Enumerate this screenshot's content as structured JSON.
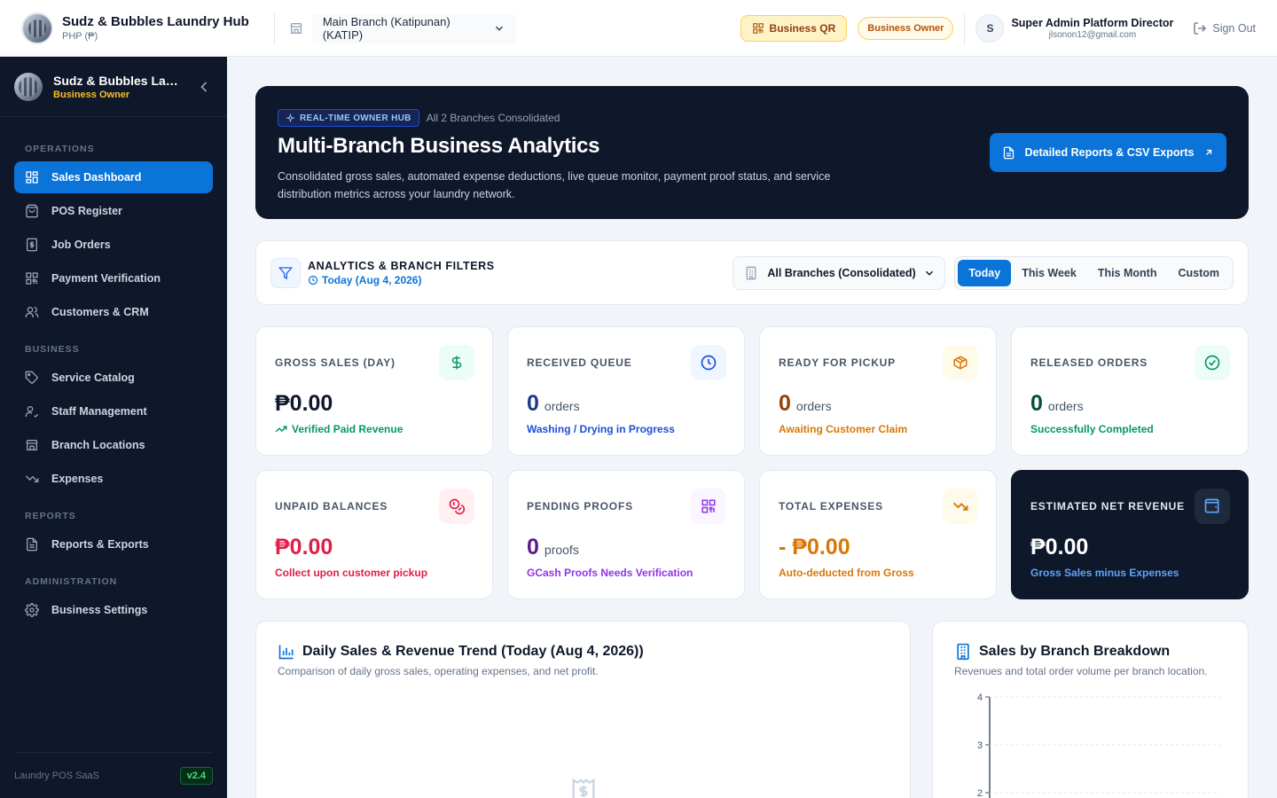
{
  "header": {
    "brand_name": "Sudz & Bubbles Laundry Hub",
    "currency": "PHP (₱)",
    "branch_select": "Main Branch (Katipunan) (KATIP)",
    "business_qr": "Business QR",
    "role_badge": "Business Owner",
    "user_initial": "S",
    "user_name": "Super Admin Platform Director",
    "user_email": "jlsonon12@gmail.com",
    "sign_out": "Sign Out"
  },
  "sidebar": {
    "name": "Sudz & Bubbles Laundry Hub",
    "role": "Business Owner",
    "sections": [
      {
        "title": "OPERATIONS",
        "items": [
          {
            "label": "Sales Dashboard",
            "icon": "dashboard-icon",
            "active": true
          },
          {
            "label": "POS Register",
            "icon": "pos-icon"
          },
          {
            "label": "Job Orders",
            "icon": "job-orders-icon"
          },
          {
            "label": "Payment Verification",
            "icon": "qr-verify-icon"
          },
          {
            "label": "Customers & CRM",
            "icon": "users-icon"
          }
        ]
      },
      {
        "title": "BUSINESS",
        "items": [
          {
            "label": "Service Catalog",
            "icon": "tag-icon"
          },
          {
            "label": "Staff Management",
            "icon": "staff-icon"
          },
          {
            "label": "Branch Locations",
            "icon": "store-icon"
          },
          {
            "label": "Expenses",
            "icon": "trend-down-icon"
          }
        ]
      },
      {
        "title": "REPORTS",
        "items": [
          {
            "label": "Reports & Exports",
            "icon": "document-icon"
          }
        ]
      },
      {
        "title": "ADMINISTRATION",
        "items": [
          {
            "label": "Business Settings",
            "icon": "gear-icon"
          }
        ]
      }
    ],
    "footer_label": "Laundry POS SaaS",
    "version": "v2.4"
  },
  "hero": {
    "tag": "REAL-TIME OWNER HUB",
    "subtitle": "All 2 Branches Consolidated",
    "title": "Multi-Branch Business Analytics",
    "description": "Consolidated gross sales, automated expense deductions, live queue monitor, payment proof status, and service distribution metrics across your laundry network.",
    "button": "Detailed Reports & CSV Exports"
  },
  "filters": {
    "title": "ANALYTICS & BRANCH FILTERS",
    "date": "Today (Aug 4, 2026)",
    "branch_select": "All Branches (Consolidated)",
    "ranges": [
      "Today",
      "This Week",
      "This Month",
      "Custom"
    ],
    "active_range": "Today"
  },
  "cards": [
    {
      "label": "GROSS SALES (DAY)",
      "value": "₱0.00",
      "unit": "",
      "note": "Verified Paid Revenue",
      "icon": "dollar-icon",
      "accent": "#059669"
    },
    {
      "label": "RECEIVED QUEUE",
      "value": "0",
      "unit": "orders",
      "note": "Washing / Drying in Progress",
      "icon": "clock-icon",
      "accent": "#1d4ed8"
    },
    {
      "label": "READY FOR PICKUP",
      "value": "0",
      "unit": "orders",
      "note": "Awaiting Customer Claim",
      "icon": "package-icon",
      "accent": "#d97706"
    },
    {
      "label": "RELEASED ORDERS",
      "value": "0",
      "unit": "orders",
      "note": "Successfully Completed",
      "icon": "check-circle-icon",
      "accent": "#059669"
    },
    {
      "label": "UNPAID BALANCES",
      "value": "₱0.00",
      "unit": "",
      "note": "Collect upon customer pickup",
      "icon": "coins-icon",
      "accent": "#e11d48"
    },
    {
      "label": "PENDING PROOFS",
      "value": "0",
      "unit": "proofs",
      "note": "GCash Proofs Needs Verification",
      "icon": "qr-code-icon",
      "accent": "#9333ea"
    },
    {
      "label": "TOTAL EXPENSES",
      "value": "- ₱0.00",
      "unit": "",
      "note": "Auto-deducted from Gross",
      "icon": "trend-down-icon",
      "accent": "#d97706"
    },
    {
      "label": "ESTIMATED NET REVENUE",
      "value": "₱0.00",
      "unit": "",
      "note": "Gross Sales minus Expenses",
      "icon": "wallet-icon",
      "accent": "#60a5fa"
    }
  ],
  "trend_panel": {
    "title": "Daily Sales & Revenue Trend (Today (Aug 4, 2026))",
    "subtitle": "Comparison of daily gross sales, operating expenses, and net profit."
  },
  "branch_panel": {
    "title": "Sales by Branch Breakdown",
    "subtitle": "Revenues and total order volume per branch location."
  },
  "chart_data": {
    "type": "bar",
    "title": "Sales by Branch Breakdown",
    "categories": [],
    "values": [],
    "ylim": [
      0,
      4
    ],
    "y_ticks": [
      "4",
      "3",
      "2"
    ],
    "grid": true
  }
}
